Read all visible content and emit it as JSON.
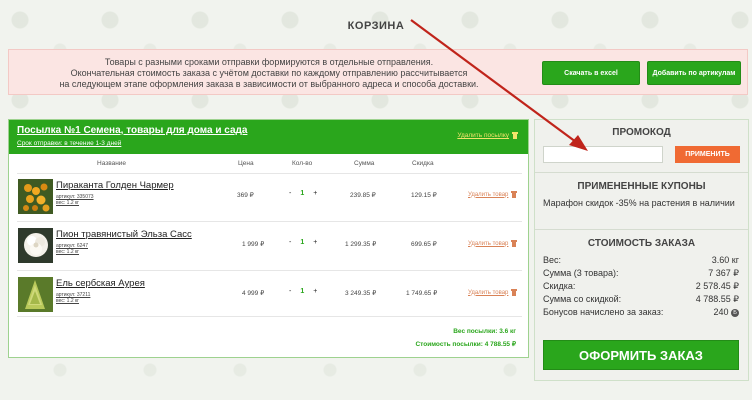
{
  "page": {
    "title": "КОРЗИНА"
  },
  "notice": {
    "lines": [
      "Товары с разными сроками отправки формируются в отдельные отправления.",
      "Окончательная стоимость заказа с учётом доставки по каждому отправлению рассчитывается",
      "на следующем этапе оформления заказа в зависимости от выбранного адреса и способа доставки."
    ],
    "excel_button": "Скачать в excel",
    "articles_button": "Добавить по артикулам"
  },
  "parcel": {
    "title": "Посылка №1 Семена, товары для дома и сада",
    "shipping": "Срок отправки: в течение 1-3 дней",
    "delete_label": "Удалить посылку",
    "columns": {
      "name": "Название",
      "price": "Цена",
      "qty": "Кол-во",
      "sum": "Сумма",
      "discount": "Скидка"
    },
    "items": [
      {
        "name": "Пираканта Голден Чармер",
        "article": "артикул: 335073",
        "weight": "вес: 1.2 кг",
        "price": "369 ₽",
        "minus": "-",
        "qty": "1",
        "plus": "+",
        "sum": "239.85 ₽",
        "discount": "129.15 ₽",
        "delete": "Удалить товар"
      },
      {
        "name": "Пион травянистый Эльза Сасс",
        "article": "артикул: 6247",
        "weight": "вес: 1.2 кг",
        "price": "1 999 ₽",
        "minus": "-",
        "qty": "1",
        "plus": "+",
        "sum": "1 299.35 ₽",
        "discount": "699.65 ₽",
        "delete": "Удалить товар"
      },
      {
        "name": "Ель сербская Аурея",
        "article": "артикул: 37211",
        "weight": "вес: 1.2 кг",
        "price": "4 999 ₽",
        "minus": "-",
        "qty": "1",
        "plus": "+",
        "sum": "3 249.35 ₽",
        "discount": "1 749.65 ₽",
        "delete": "Удалить товар"
      }
    ],
    "weight_total": "Вес посылки: 3.6 кг",
    "cost_total": "Стоимость посылки: 4 788.55 ₽"
  },
  "sidebar": {
    "promo_title": "ПРОМОКОД",
    "promo_placeholder": "",
    "promo_button": "ПРИМЕНИТЬ",
    "coupons_title": "ПРИМЕНЕННЫЕ КУПОНЫ",
    "coupon": "Марафон скидок -35% на растения в наличии",
    "cost_title": "СТОИМОСТЬ ЗАКАЗА",
    "summary": [
      {
        "label": "Вес:",
        "value": "3.60 кг"
      },
      {
        "label": "Сумма (3 товара):",
        "value": "7 367 ₽"
      },
      {
        "label": "Скидка:",
        "value": "2 578.45 ₽"
      },
      {
        "label": "Сумма со скидкой:",
        "value": "4 788.55 ₽"
      },
      {
        "label": "Бонусов начислено за заказ:",
        "value": "240"
      }
    ],
    "bonus_symbol": "Б",
    "order_button": "ОФОРМИТЬ ЗАКАЗ"
  },
  "colors": {
    "accent_green": "#2aa61c",
    "promo_orange": "#f06a33",
    "notice_bg": "#fbe5e3",
    "arrow": "#c0241b"
  },
  "icons": [
    "trash-icon",
    "product-photo",
    "bonus-icon"
  ]
}
